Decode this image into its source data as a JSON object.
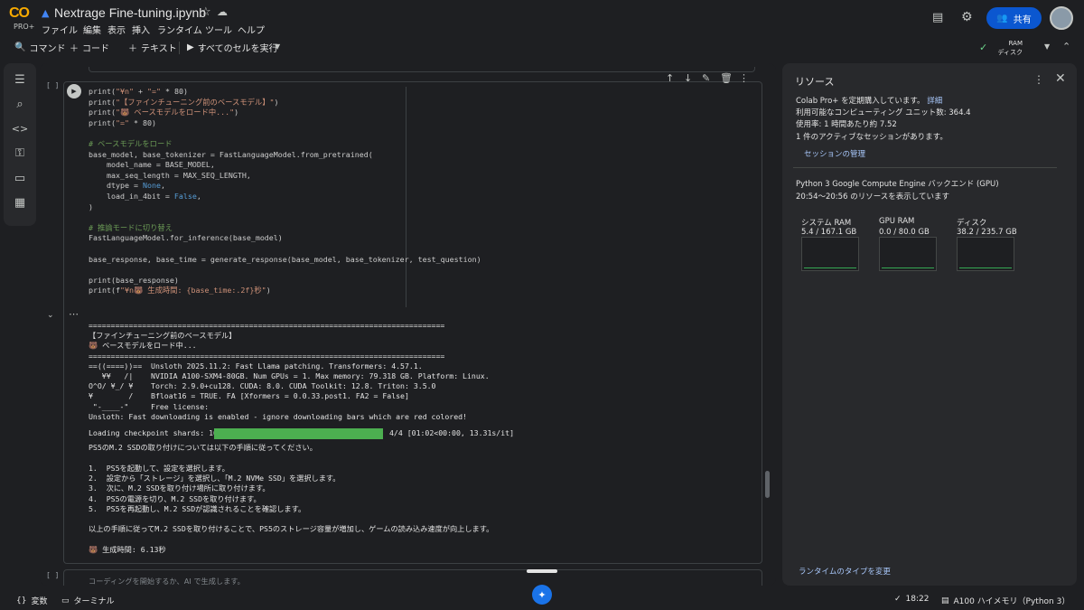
{
  "app": {
    "logo_text": "CO",
    "plan": "PRO+",
    "file_name": "Nextrage Fine-tuning.ipynb",
    "share_label": "共有"
  },
  "menu": [
    "ファイル",
    "編集",
    "表示",
    "挿入",
    "ランタイム",
    "ツール",
    "ヘルプ"
  ],
  "toolbar": {
    "command": "コマンド",
    "code": "コード",
    "text": "テキスト",
    "run_all": "すべてのセルを実行",
    "ram_label": "RAM",
    "disk_label": "ディスク"
  },
  "code_lines": [
    "print(\"¥n\" + \"=\" * 80)",
    "print(\"【ファインチューニング前のベースモデル】\")",
    "print(\"🐻 ベースモデルをロード中...\")",
    "print(\"=\" * 80)",
    "",
    "# ベースモデルをロード",
    "base_model, base_tokenizer = FastLanguageModel.from_pretrained(",
    "    model_name = BASE_MODEL,",
    "    max_seq_length = MAX_SEQ_LENGTH,",
    "    dtype = None,",
    "    load_in_4bit = False,",
    ")",
    "",
    "# 推論モードに切り替え",
    "FastLanguageModel.for_inference(base_model)",
    "",
    "base_response, base_time = generate_response(base_model, base_tokenizer, test_question)",
    "",
    "print(base_response)",
    "print(f\"¥n🐻 生成時間: {base_time:.2f}秒\")"
  ],
  "output_lines_top": [
    "================================================================================",
    "【ファインチューニング前のベースモデル】",
    "🐻 ベースモデルをロード中...",
    "================================================================================",
    "==((====))==  Unsloth 2025.11.2: Fast Llama patching. Transformers: 4.57.1.",
    "   ¥¥   /|    NVIDIA A100-SXM4-80GB. Num GPUs = 1. Max memory: 79.318 GB. Platform: Linux.",
    "O^O/ ¥_/ ¥    Torch: 2.9.0+cu128. CUDA: 8.0. CUDA Toolkit: 12.8. Triton: 3.5.0",
    "¥        /    Bfloat16 = TRUE. FA [Xformers = 0.0.33.post1. FA2 = False]",
    " \"-____-\"     Free license: ",
    "Unsloth: Fast downloading is enabled - ignore downloading bars which are red colored!"
  ],
  "license_link": "http://github.com/unslothai/unsloth",
  "progress": {
    "label": "Loading checkpoint shards: 100%",
    "fraction": 1.0,
    "stats": "4/4 [01:02<00:00, 13.31s/it]"
  },
  "output_lines_bottom": [
    "PS5のM.2 SSDの取り付けについては以下の手順に従ってください。",
    "",
    "1.  PS5を起動して、設定を選択します。",
    "2.  設定から「ストレージ」を選択し、「M.2 NVMe SSD」を選択します。",
    "3.  次に、M.2 SSDを取り付け場所に取り付けます。",
    "4.  PS5の電源を切り、M.2 SSDを取り付けます。",
    "5.  PS5を再起動し、M.2 SSDが認識されることを確認します。",
    "",
    "以上の手順に従ってM.2 SSDを取り付けることで、PS5のストレージ容量が増加し、ゲームの読み込み速度が向上します。",
    "",
    "🐻 生成時間: 6.13秒"
  ],
  "next_cell_placeholder": "コーディングを開始するか、AI で生成します。",
  "cell_bracket": "[ ]",
  "resources": {
    "title": "リソース",
    "line1": "Colab Pro+ を定期購入しています。",
    "detail_link": "詳細",
    "line2": "利用可能なコンピューティング ユニット数: 364.4",
    "line3": "使用率: 1 時間あたり約 7.52",
    "line4": "1 件のアクティブなセッションがあります。",
    "manage_sessions": "セッションの管理",
    "backend": "Python 3 Google Compute Engine バックエンド (GPU)",
    "range": "20:54〜20:56 のリソースを表示しています",
    "gauges": [
      {
        "label": "システム RAM",
        "value": "5.4 / 167.1 GB"
      },
      {
        "label": "GPU RAM",
        "value": "0.0 / 80.0 GB"
      },
      {
        "label": "ディスク",
        "value": "38.2 / 235.7 GB"
      }
    ],
    "change_runtime": "ランタイムのタイプを変更"
  },
  "status": {
    "variables": "変数",
    "terminal": "ターミナル",
    "time": "18:22",
    "runtime": "A100 ハイメモリ（Python 3）"
  },
  "colors": {
    "accent": "#a8c7fa",
    "progress": "#4caf50",
    "share_bg": "#0b57d0"
  }
}
